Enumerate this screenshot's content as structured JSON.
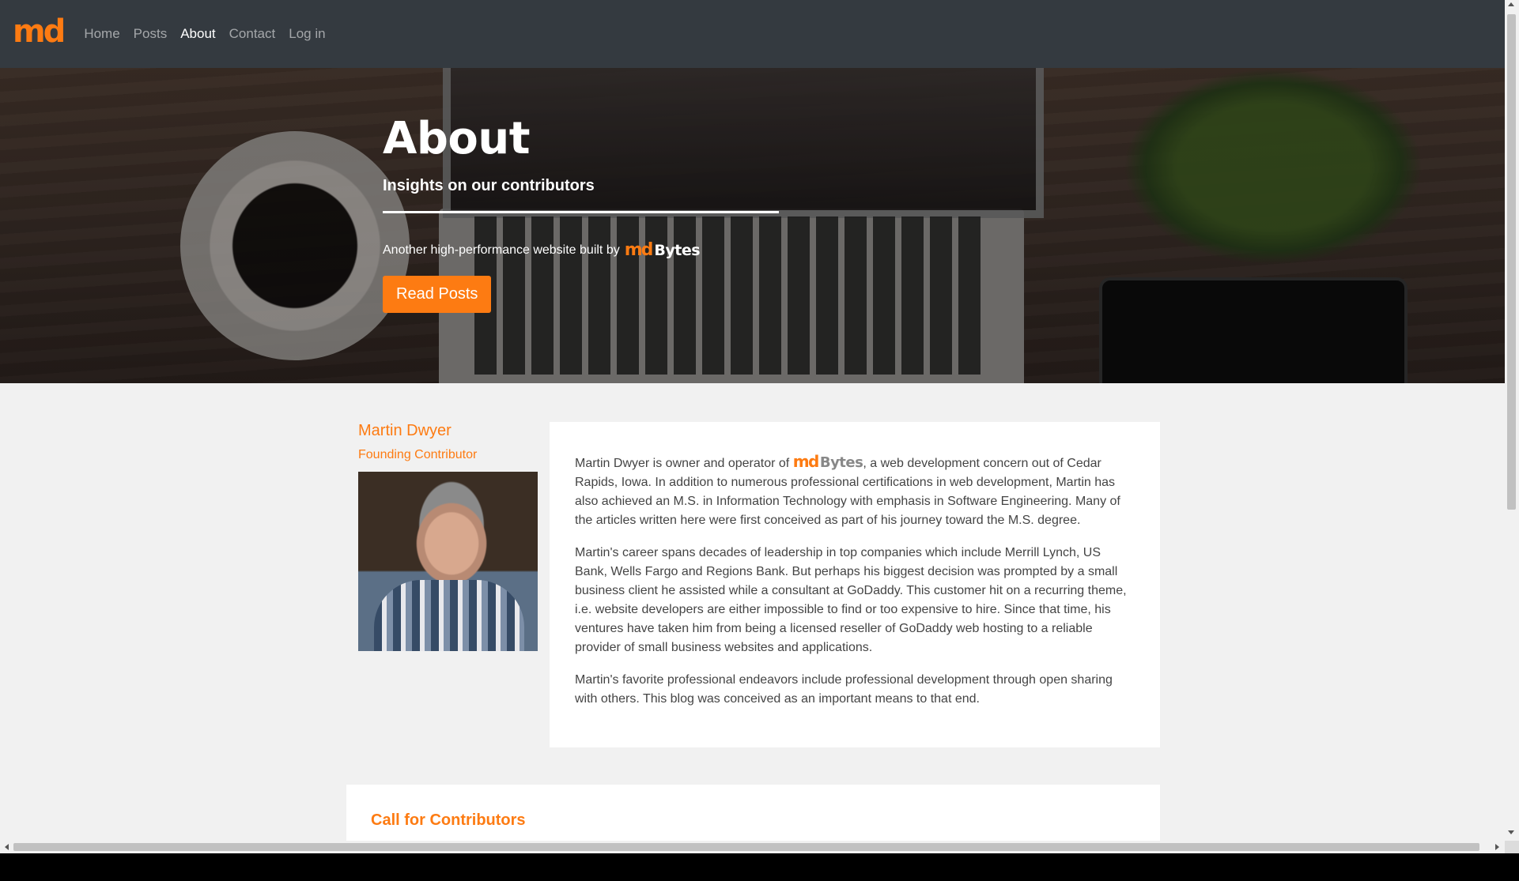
{
  "navbar": {
    "logo": "md",
    "links": [
      {
        "label": "Home",
        "active": false
      },
      {
        "label": "Posts",
        "active": false
      },
      {
        "label": "About",
        "active": true
      },
      {
        "label": "Contact",
        "active": false
      },
      {
        "label": "Log in",
        "active": false
      }
    ]
  },
  "hero": {
    "title": "About",
    "subtitle": "Insights on our contributors",
    "built_by_text": "Another high-performance website built by",
    "brand_md": "md",
    "brand_bytes": "Bytes",
    "cta_label": "Read Posts"
  },
  "profile": {
    "name": "Martin Dwyer",
    "role": "Founding Contributor",
    "photo_icon": "portrait-photo"
  },
  "bio": {
    "p1_before": "Martin Dwyer is owner and operator of",
    "brand_md": "md",
    "brand_bytes": "Bytes",
    "p1_after": ", a web development concern out of Cedar Rapids, Iowa. In addition to numerous professional certifications in web development, Martin has also achieved an M.S. in Information Technology with emphasis in Software Engineering. Many of the articles written here were first conceived as part of his journey toward the M.S. degree.",
    "p2": "Martin's career spans decades of leadership in top companies which include Merrill Lynch, US Bank, Wells Fargo and Regions Bank.   But perhaps his biggest decision was prompted by a small business client he assisted while a consultant at GoDaddy.  This customer hit on a recurring theme, i.e. website developers are either impossible to find or too expensive to hire.  Since that time, his ventures have taken him from being a licensed reseller of GoDaddy web hosting to a reliable provider of small business websites and applications.",
    "p3": "Martin's favorite professional endeavors include professional development through open sharing with others. This blog was conceived as an important means to that end."
  },
  "contributors": {
    "title": "Call for Contributors"
  },
  "colors": {
    "accent": "#fd7b12",
    "navbar": "#343a40",
    "page_bg": "#f1f1f1"
  }
}
